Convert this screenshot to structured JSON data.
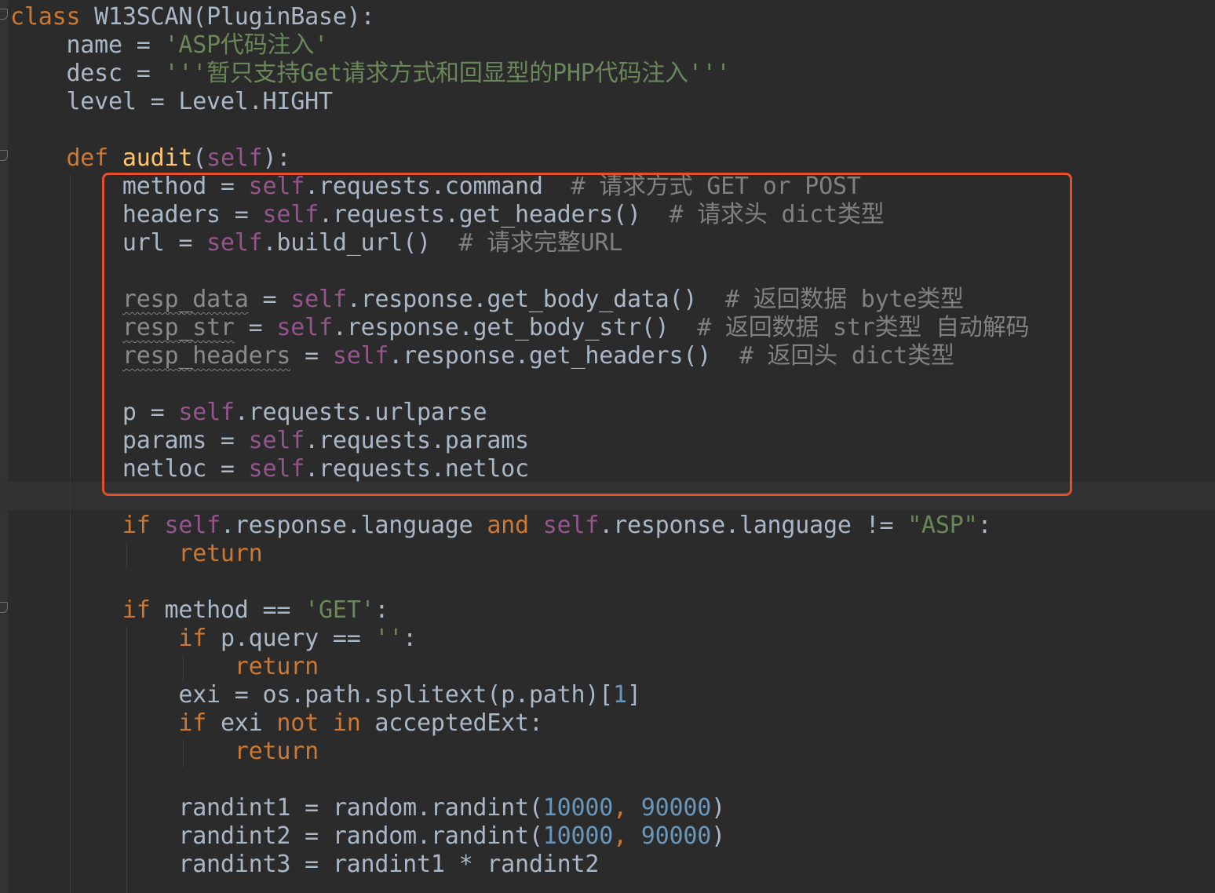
{
  "editor": {
    "lines": [
      {
        "segs": [
          {
            "c": "kw",
            "t": "class "
          },
          {
            "c": "pl",
            "t": "W13SCAN(PluginBase):"
          }
        ]
      },
      {
        "segs": [
          {
            "c": "pl",
            "t": "    name = "
          },
          {
            "c": "st",
            "t": "'ASP代码注入'"
          }
        ]
      },
      {
        "segs": [
          {
            "c": "pl",
            "t": "    desc = "
          },
          {
            "c": "st",
            "t": "'''暂只支持Get请求方式和回显型的PHP代码注入'''"
          }
        ]
      },
      {
        "segs": [
          {
            "c": "pl",
            "t": "    level = Level.HIGHT"
          }
        ]
      },
      {
        "segs": [
          {
            "c": "pl",
            "t": ""
          }
        ]
      },
      {
        "segs": [
          {
            "c": "kw",
            "t": "    def "
          },
          {
            "c": "fn",
            "t": "audit"
          },
          {
            "c": "pl",
            "t": "("
          },
          {
            "c": "sf",
            "t": "self"
          },
          {
            "c": "pl",
            "t": "):"
          }
        ]
      },
      {
        "segs": [
          {
            "c": "pl",
            "t": "        method = "
          },
          {
            "c": "sf",
            "t": "self"
          },
          {
            "c": "pl",
            "t": ".requests.command  "
          },
          {
            "c": "cm",
            "t": "# 请求方式 GET or POST"
          }
        ]
      },
      {
        "segs": [
          {
            "c": "pl",
            "t": "        headers = "
          },
          {
            "c": "sf",
            "t": "self"
          },
          {
            "c": "pl",
            "t": ".requests.get_headers()  "
          },
          {
            "c": "cm",
            "t": "# 请求头 dict类型"
          }
        ]
      },
      {
        "segs": [
          {
            "c": "pl",
            "t": "        url = "
          },
          {
            "c": "sf",
            "t": "self"
          },
          {
            "c": "pl",
            "t": ".build_url()  "
          },
          {
            "c": "cm",
            "t": "# 请求完整URL"
          }
        ]
      },
      {
        "segs": [
          {
            "c": "pl",
            "t": ""
          }
        ]
      },
      {
        "segs": [
          {
            "c": "pl",
            "t": "        "
          },
          {
            "c": "wv",
            "t": "resp_data"
          },
          {
            "c": "pl",
            "t": " = "
          },
          {
            "c": "sf",
            "t": "self"
          },
          {
            "c": "pl",
            "t": ".response.get_body_data()  "
          },
          {
            "c": "cm",
            "t": "# 返回数据 byte类型"
          }
        ]
      },
      {
        "segs": [
          {
            "c": "pl",
            "t": "        "
          },
          {
            "c": "wv",
            "t": "resp_str"
          },
          {
            "c": "pl",
            "t": " = "
          },
          {
            "c": "sf",
            "t": "self"
          },
          {
            "c": "pl",
            "t": ".response.get_body_str()  "
          },
          {
            "c": "cm",
            "t": "# 返回数据 str类型 自动解码"
          }
        ]
      },
      {
        "segs": [
          {
            "c": "pl",
            "t": "        "
          },
          {
            "c": "wv",
            "t": "resp_headers"
          },
          {
            "c": "pl",
            "t": " = "
          },
          {
            "c": "sf",
            "t": "self"
          },
          {
            "c": "pl",
            "t": ".response.get_headers()  "
          },
          {
            "c": "cm",
            "t": "# 返回头 dict类型"
          }
        ]
      },
      {
        "segs": [
          {
            "c": "pl",
            "t": ""
          }
        ]
      },
      {
        "segs": [
          {
            "c": "pl",
            "t": "        p = "
          },
          {
            "c": "sf",
            "t": "self"
          },
          {
            "c": "pl",
            "t": ".requests.urlparse"
          }
        ]
      },
      {
        "segs": [
          {
            "c": "pl",
            "t": "        params = "
          },
          {
            "c": "sf",
            "t": "self"
          },
          {
            "c": "pl",
            "t": ".requests.params"
          }
        ]
      },
      {
        "segs": [
          {
            "c": "pl",
            "t": "        netloc = "
          },
          {
            "c": "sf",
            "t": "self"
          },
          {
            "c": "pl",
            "t": ".requests.netloc"
          }
        ]
      },
      {
        "segs": [
          {
            "c": "pl",
            "t": ""
          }
        ]
      },
      {
        "segs": [
          {
            "c": "kw",
            "t": "        if "
          },
          {
            "c": "sf",
            "t": "self"
          },
          {
            "c": "pl",
            "t": ".response.language "
          },
          {
            "c": "kw",
            "t": "and "
          },
          {
            "c": "sf",
            "t": "self"
          },
          {
            "c": "pl",
            "t": ".response.language != "
          },
          {
            "c": "st",
            "t": "\"ASP\""
          },
          {
            "c": "pl",
            "t": ":"
          }
        ]
      },
      {
        "segs": [
          {
            "c": "kw",
            "t": "            return"
          }
        ]
      },
      {
        "segs": [
          {
            "c": "pl",
            "t": ""
          }
        ]
      },
      {
        "segs": [
          {
            "c": "kw",
            "t": "        if "
          },
          {
            "c": "pl",
            "t": "method == "
          },
          {
            "c": "st",
            "t": "'GET'"
          },
          {
            "c": "pl",
            "t": ":"
          }
        ]
      },
      {
        "segs": [
          {
            "c": "kw",
            "t": "            if "
          },
          {
            "c": "pl",
            "t": "p.query == "
          },
          {
            "c": "st",
            "t": "''"
          },
          {
            "c": "pl",
            "t": ":"
          }
        ]
      },
      {
        "segs": [
          {
            "c": "kw",
            "t": "                return"
          }
        ]
      },
      {
        "segs": [
          {
            "c": "pl",
            "t": "            exi = os.path.splitext(p.path)["
          },
          {
            "c": "nm",
            "t": "1"
          },
          {
            "c": "pl",
            "t": "]"
          }
        ]
      },
      {
        "segs": [
          {
            "c": "kw",
            "t": "            if "
          },
          {
            "c": "pl",
            "t": "exi "
          },
          {
            "c": "kw",
            "t": "not in "
          },
          {
            "c": "pl",
            "t": "acceptedExt:"
          }
        ]
      },
      {
        "segs": [
          {
            "c": "kw",
            "t": "                return"
          }
        ]
      },
      {
        "segs": [
          {
            "c": "pl",
            "t": ""
          }
        ]
      },
      {
        "segs": [
          {
            "c": "pl",
            "t": "            randint1 = random.randint("
          },
          {
            "c": "nm",
            "t": "10000"
          },
          {
            "c": "kw",
            "t": ", "
          },
          {
            "c": "nm",
            "t": "90000"
          },
          {
            "c": "pl",
            "t": ")"
          }
        ]
      },
      {
        "segs": [
          {
            "c": "pl",
            "t": "            randint2 = random.randint("
          },
          {
            "c": "nm",
            "t": "10000"
          },
          {
            "c": "kw",
            "t": ", "
          },
          {
            "c": "nm",
            "t": "90000"
          },
          {
            "c": "pl",
            "t": ")"
          }
        ]
      },
      {
        "segs": [
          {
            "c": "pl",
            "t": "            randint3 = randint1 * randint2"
          }
        ]
      }
    ]
  },
  "colors": {
    "background": "#2b2b2b",
    "keyword": "#cc7832",
    "function": "#ffc66d",
    "self": "#94558d",
    "string": "#6a8759",
    "comment": "#808080",
    "number": "#6897bb",
    "plain": "#a9b7c6",
    "highlight_box": "#e5502b"
  }
}
